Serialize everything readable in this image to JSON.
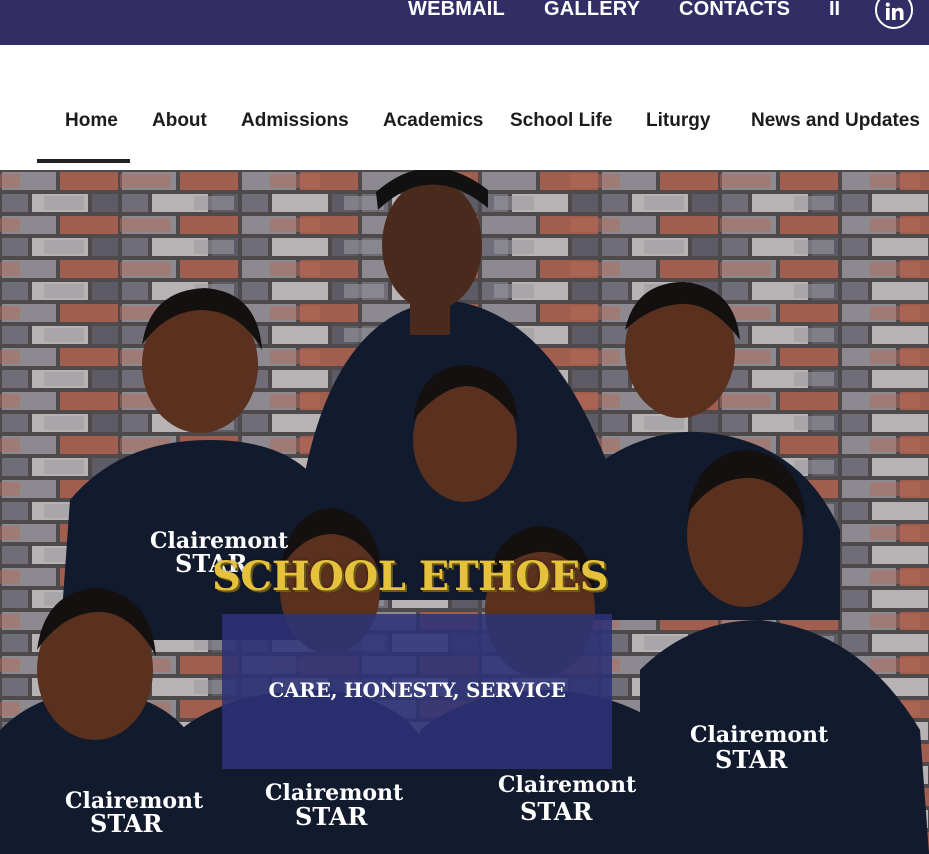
{
  "topbar": {
    "links": [
      "WEBMAIL",
      "GALLERY",
      "CONTACTS"
    ],
    "separator": "II",
    "social_icon": "linkedin-icon",
    "background": "#332d66"
  },
  "nav": {
    "items": [
      "Home",
      "About",
      "Admissions",
      "Academics",
      "School Life",
      "Liturgy",
      "News and Updates"
    ],
    "active": "Home"
  },
  "hero": {
    "title": "SCHOOL ETHOES",
    "values": "CARE, HONESTY, SERVICE",
    "title_color": "#e6c23c",
    "box_color": "#2c3278",
    "shirt_text_1": "Clairemont",
    "shirt_text_2": "STAR"
  }
}
